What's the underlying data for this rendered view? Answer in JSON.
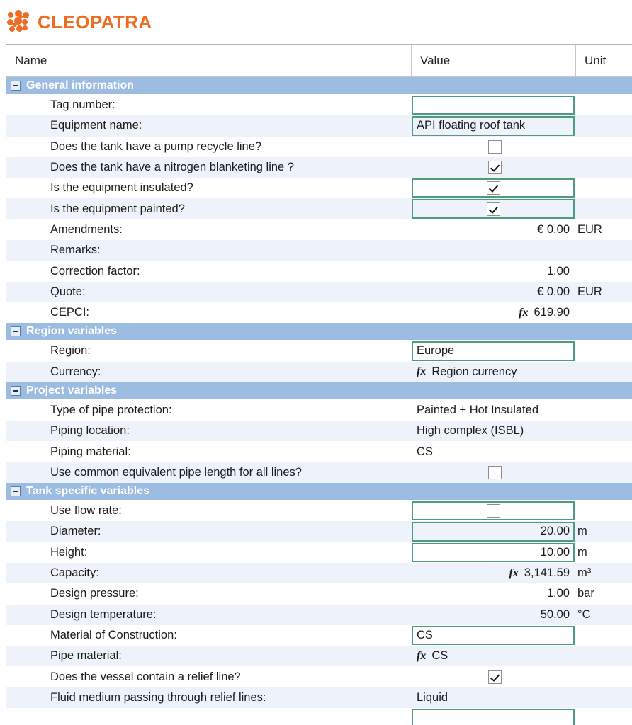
{
  "brand": {
    "name": "CLEOPATRA",
    "logo_icon": "cleopatra-dots-logo",
    "accent_color": "#ef6c22"
  },
  "colors": {
    "section_header_bg": "#9dbce1",
    "row_alt_bg": "#eef3fb",
    "input_border": "#4e9b80",
    "grid_border": "#b5b5b5"
  },
  "grid": {
    "columns": [
      "Name",
      "Value",
      "Unit"
    ],
    "sections": [
      {
        "title": "General information",
        "toggle_icon": "collapse-minus-icon",
        "rows": [
          {
            "name": "Tag number:",
            "value": "",
            "unit": "",
            "kind": "text",
            "boxed": true,
            "align": "left"
          },
          {
            "name": "Equipment name:",
            "value": "API floating roof tank",
            "unit": "",
            "kind": "text",
            "boxed": true,
            "align": "left"
          },
          {
            "name": "Does the tank have a pump recycle line?",
            "value": "",
            "unit": "",
            "kind": "checkbox",
            "checked": false,
            "boxed": false
          },
          {
            "name": "Does the tank have a nitrogen blanketing line ?",
            "value": "",
            "unit": "",
            "kind": "checkbox",
            "checked": true,
            "boxed": false
          },
          {
            "name": "Is the equipment insulated?",
            "value": "",
            "unit": "",
            "kind": "checkbox",
            "checked": true,
            "boxed": true
          },
          {
            "name": "Is the equipment painted?",
            "value": "",
            "unit": "",
            "kind": "checkbox",
            "checked": true,
            "boxed": true
          },
          {
            "name": "Amendments:",
            "value": "€ 0.00",
            "unit": "EUR",
            "kind": "text",
            "boxed": false,
            "align": "right"
          },
          {
            "name": "Remarks:",
            "value": "",
            "unit": "",
            "kind": "text",
            "boxed": false,
            "align": "left"
          },
          {
            "name": "Correction factor:",
            "value": "1.00",
            "unit": "",
            "kind": "text",
            "boxed": false,
            "align": "right"
          },
          {
            "name": "Quote:",
            "value": "€ 0.00",
            "unit": "EUR",
            "kind": "text",
            "boxed": false,
            "align": "right"
          },
          {
            "name": "CEPCI:",
            "value": "619.90",
            "unit": "",
            "kind": "formula",
            "boxed": false,
            "align": "right"
          }
        ]
      },
      {
        "title": "Region variables",
        "toggle_icon": "collapse-minus-icon",
        "rows": [
          {
            "name": "Region:",
            "value": "Europe",
            "unit": "",
            "kind": "text",
            "boxed": true,
            "align": "left"
          },
          {
            "name": "Currency:",
            "value": "Region currency",
            "unit": "",
            "kind": "formula",
            "boxed": false,
            "align": "left"
          }
        ]
      },
      {
        "title": "Project variables",
        "toggle_icon": "collapse-minus-icon",
        "rows": [
          {
            "name": "Type of pipe protection:",
            "value": "Painted + Hot Insulated",
            "unit": "",
            "kind": "text",
            "boxed": false,
            "align": "left"
          },
          {
            "name": "Piping location:",
            "value": "High complex (ISBL)",
            "unit": "",
            "kind": "text",
            "boxed": false,
            "align": "left"
          },
          {
            "name": "Piping material:",
            "value": "CS",
            "unit": "",
            "kind": "text",
            "boxed": false,
            "align": "left"
          },
          {
            "name": "Use common equivalent pipe length for all lines?",
            "value": "",
            "unit": "",
            "kind": "checkbox",
            "checked": false,
            "boxed": false
          }
        ]
      },
      {
        "title": "Tank specific variables",
        "toggle_icon": "collapse-minus-icon",
        "rows": [
          {
            "name": "Use flow rate:",
            "value": "",
            "unit": "",
            "kind": "checkbox",
            "checked": false,
            "boxed": true
          },
          {
            "name": "Diameter:",
            "value": "20.00",
            "unit": "m",
            "kind": "text",
            "boxed": true,
            "align": "right"
          },
          {
            "name": "Height:",
            "value": "10.00",
            "unit": "m",
            "kind": "text",
            "boxed": true,
            "align": "right"
          },
          {
            "name": "Capacity:",
            "value": "3,141.59",
            "unit": "m³",
            "kind": "formula",
            "boxed": false,
            "align": "right"
          },
          {
            "name": "Design pressure:",
            "value": "1.00",
            "unit": "bar",
            "kind": "text",
            "boxed": false,
            "align": "right"
          },
          {
            "name": "Design temperature:",
            "value": "50.00",
            "unit": "°C",
            "kind": "text",
            "boxed": false,
            "align": "right"
          },
          {
            "name": "Material of Construction:",
            "value": "CS",
            "unit": "",
            "kind": "text",
            "boxed": true,
            "align": "left"
          },
          {
            "name": "Pipe material:",
            "value": "CS",
            "unit": "",
            "kind": "formula",
            "boxed": false,
            "align": "left"
          },
          {
            "name": "Does the vessel contain a relief line?",
            "value": "",
            "unit": "",
            "kind": "checkbox",
            "checked": true,
            "boxed": false
          },
          {
            "name": "Fluid medium passing through relief lines:",
            "value": "Liquid",
            "unit": "",
            "kind": "text",
            "boxed": false,
            "align": "left"
          },
          {
            "name": "",
            "value": "",
            "unit": "",
            "kind": "text",
            "boxed": true,
            "align": "left",
            "partial": true
          }
        ]
      }
    ]
  }
}
